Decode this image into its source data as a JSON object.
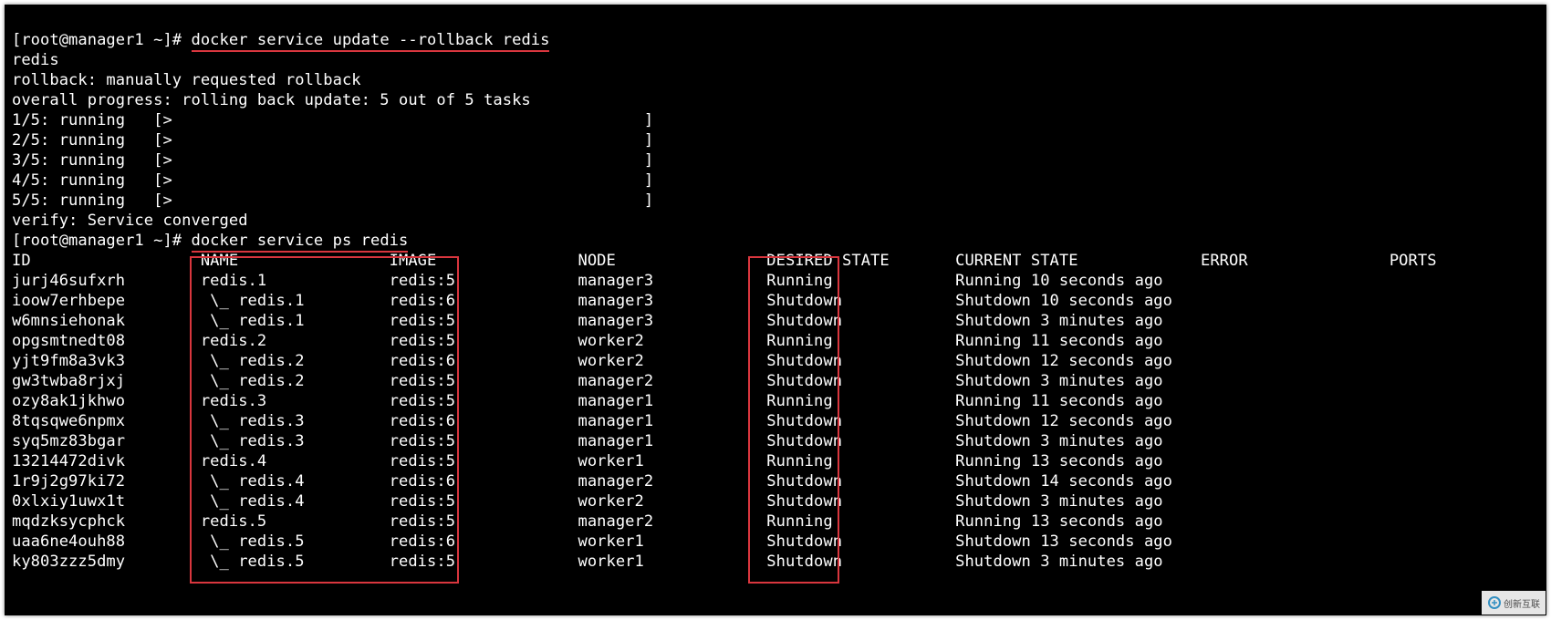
{
  "prompt1": {
    "user_host": "[root@manager1 ~]# ",
    "command": "docker service update --rollback redis"
  },
  "output_lines": [
    "redis",
    "rollback: manually requested rollback",
    "overall progress: rolling back update: 5 out of 5 tasks"
  ],
  "progress_lines": [
    "1/5: running   [>                                                  ]",
    "2/5: running   [>                                                  ]",
    "3/5: running   [>                                                  ]",
    "4/5: running   [>                                                  ]",
    "5/5: running   [>                                                  ]"
  ],
  "verify_line": "verify: Service converged",
  "prompt2": {
    "user_host": "[root@manager1 ~]# ",
    "command": "docker service ps redis"
  },
  "table_header": {
    "id": "ID",
    "name": "NAME",
    "image": "IMAGE",
    "node": "NODE",
    "desired_state": "DESIRED STATE",
    "current_state": "CURRENT STATE",
    "error": "ERROR",
    "ports": "PORTS"
  },
  "rows": [
    {
      "id": "jurj46sufxrh",
      "name": "redis.1",
      "image": "redis:5",
      "node": "manager3",
      "desired_state": "Running",
      "current_state": "Running 10 seconds ago",
      "error": "",
      "ports": ""
    },
    {
      "id": "ioow7erhbepe",
      "name": " \\_ redis.1",
      "image": "redis:6",
      "node": "manager3",
      "desired_state": "Shutdown",
      "current_state": "Shutdown 10 seconds ago",
      "error": "",
      "ports": ""
    },
    {
      "id": "w6mnsiehonak",
      "name": " \\_ redis.1",
      "image": "redis:5",
      "node": "manager3",
      "desired_state": "Shutdown",
      "current_state": "Shutdown 3 minutes ago",
      "error": "",
      "ports": ""
    },
    {
      "id": "opgsmtnedt08",
      "name": "redis.2",
      "image": "redis:5",
      "node": "worker2",
      "desired_state": "Running",
      "current_state": "Running 11 seconds ago",
      "error": "",
      "ports": ""
    },
    {
      "id": "yjt9fm8a3vk3",
      "name": " \\_ redis.2",
      "image": "redis:6",
      "node": "worker2",
      "desired_state": "Shutdown",
      "current_state": "Shutdown 12 seconds ago",
      "error": "",
      "ports": ""
    },
    {
      "id": "gw3twba8rjxj",
      "name": " \\_ redis.2",
      "image": "redis:5",
      "node": "manager2",
      "desired_state": "Shutdown",
      "current_state": "Shutdown 3 minutes ago",
      "error": "",
      "ports": ""
    },
    {
      "id": "ozy8ak1jkhwo",
      "name": "redis.3",
      "image": "redis:5",
      "node": "manager1",
      "desired_state": "Running",
      "current_state": "Running 11 seconds ago",
      "error": "",
      "ports": ""
    },
    {
      "id": "8tqsqwe6npmx",
      "name": " \\_ redis.3",
      "image": "redis:6",
      "node": "manager1",
      "desired_state": "Shutdown",
      "current_state": "Shutdown 12 seconds ago",
      "error": "",
      "ports": ""
    },
    {
      "id": "syq5mz83bgar",
      "name": " \\_ redis.3",
      "image": "redis:5",
      "node": "manager1",
      "desired_state": "Shutdown",
      "current_state": "Shutdown 3 minutes ago",
      "error": "",
      "ports": ""
    },
    {
      "id": "13214472divk",
      "name": "redis.4",
      "image": "redis:5",
      "node": "worker1",
      "desired_state": "Running",
      "current_state": "Running 13 seconds ago",
      "error": "",
      "ports": ""
    },
    {
      "id": "1r9j2g97ki72",
      "name": " \\_ redis.4",
      "image": "redis:6",
      "node": "manager2",
      "desired_state": "Shutdown",
      "current_state": "Shutdown 14 seconds ago",
      "error": "",
      "ports": ""
    },
    {
      "id": "0xlxiy1uwx1t",
      "name": " \\_ redis.4",
      "image": "redis:5",
      "node": "worker2",
      "desired_state": "Shutdown",
      "current_state": "Shutdown 3 minutes ago",
      "error": "",
      "ports": ""
    },
    {
      "id": "mqdzksycphck",
      "name": "redis.5",
      "image": "redis:5",
      "node": "manager2",
      "desired_state": "Running",
      "current_state": "Running 13 seconds ago",
      "error": "",
      "ports": ""
    },
    {
      "id": "uaa6ne4ouh88",
      "name": " \\_ redis.5",
      "image": "redis:6",
      "node": "worker1",
      "desired_state": "Shutdown",
      "current_state": "Shutdown 13 seconds ago",
      "error": "",
      "ports": ""
    },
    {
      "id": "ky803zzz5dmy",
      "name": " \\_ redis.5",
      "image": "redis:5",
      "node": "worker1",
      "desired_state": "Shutdown",
      "current_state": "Shutdown 3 minutes ago",
      "error": "",
      "ports": ""
    }
  ],
  "watermark": "创新互联"
}
